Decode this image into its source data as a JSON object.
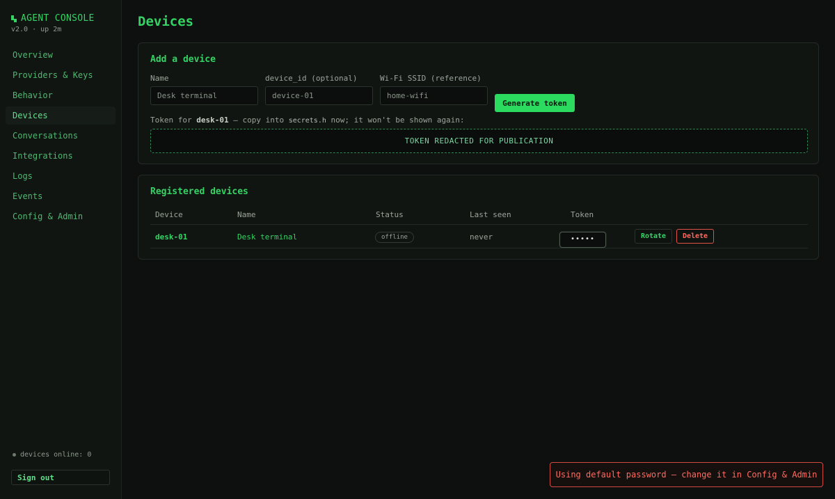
{
  "brand": {
    "title": "AGENT CONSOLE",
    "subtitle": "v2.0 · up 2m"
  },
  "sidebar": {
    "items": [
      {
        "label": "Overview"
      },
      {
        "label": "Providers & Keys"
      },
      {
        "label": "Behavior"
      },
      {
        "label": "Devices",
        "active": true
      },
      {
        "label": "Conversations"
      },
      {
        "label": "Integrations"
      },
      {
        "label": "Logs"
      },
      {
        "label": "Events"
      },
      {
        "label": "Config & Admin"
      }
    ],
    "status": "devices online: 0",
    "signout": "Sign out"
  },
  "page": {
    "title": "Devices"
  },
  "add_device": {
    "title": "Add a device",
    "fields": [
      {
        "label": "Name",
        "placeholder": "Desk terminal"
      },
      {
        "label": "device_id (optional)",
        "placeholder": "device-01"
      },
      {
        "label": "Wi-Fi SSID (reference)",
        "placeholder": "home-wifi"
      }
    ],
    "generate_label": "Generate token",
    "token_note": {
      "prefix": "Token for ",
      "device": "desk-01",
      "middle": " — copy into ",
      "file": "secrets.h",
      "suffix": " now; it won't be shown again:"
    },
    "token_value": "TOKEN REDACTED FOR PUBLICATION"
  },
  "registered": {
    "title": "Registered devices",
    "columns": [
      "Device",
      "Name",
      "Status",
      "Last seen",
      "Token"
    ],
    "rows": [
      {
        "device": "desk-01",
        "name": "Desk terminal",
        "status": "offline",
        "last_seen": "never",
        "token_mask": "•••••",
        "rotate": "Rotate",
        "delete": "Delete"
      }
    ]
  },
  "toast": "Using default password — change it in Config & Admin",
  "colors": {
    "accent": "#34d364",
    "danger": "#ff6a5e",
    "background": "#0d100e"
  }
}
